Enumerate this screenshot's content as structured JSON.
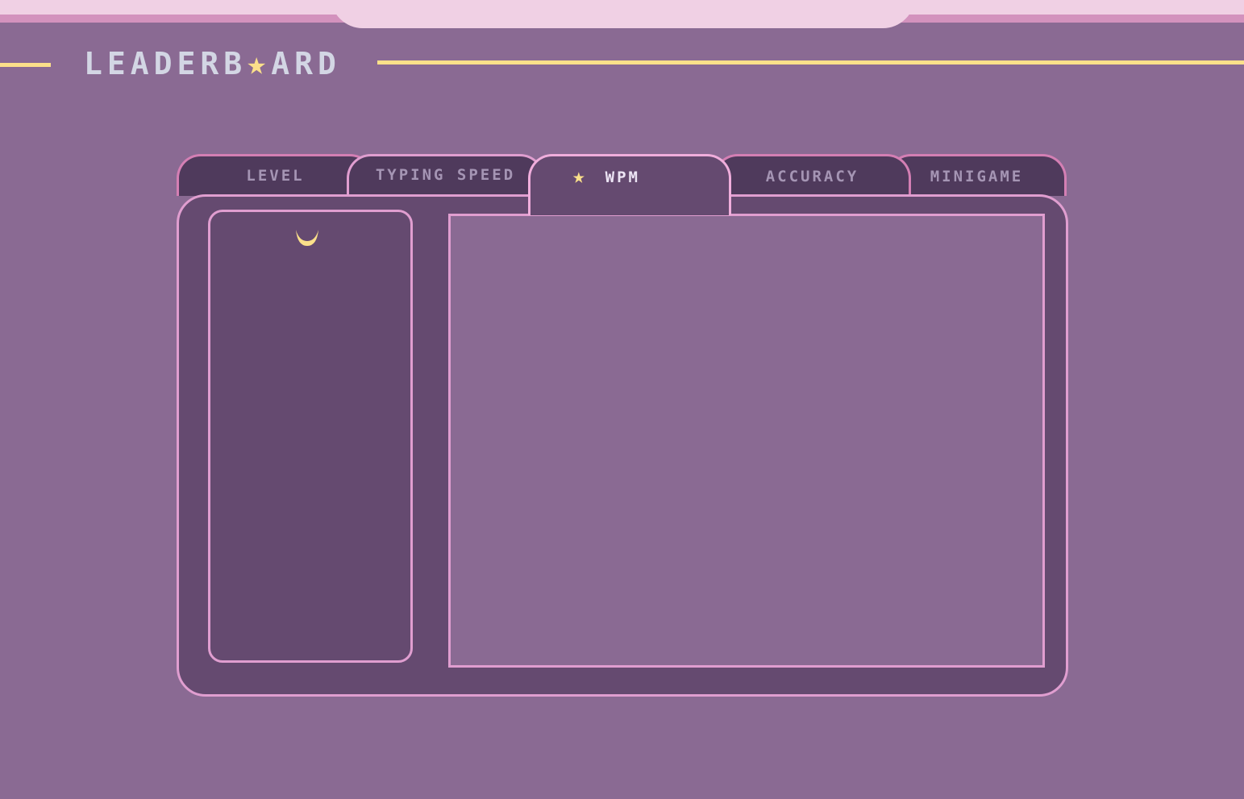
{
  "header": {
    "title_part1": "LEADERB",
    "title_star": "★",
    "title_part2": "ARD"
  },
  "tabs": [
    {
      "id": "level",
      "label": "LEVEL",
      "active": false
    },
    {
      "id": "typing_speed",
      "label": "TYPING SPEED",
      "active": false
    },
    {
      "id": "wpm",
      "label": "WPM",
      "active": true,
      "icon": "star-icon"
    },
    {
      "id": "accuracy",
      "label": "ACCURACY",
      "active": false
    },
    {
      "id": "minigame",
      "label": "MINIGAME",
      "active": false
    }
  ],
  "tab_star": "★",
  "sidebar": {
    "icon": "moon-icon"
  },
  "colors": {
    "background": "#8a6a93",
    "panel": "#654a70",
    "border_pink": "#e09ed0",
    "accent_yellow": "#fbe08a",
    "title_text": "#d3d6e4"
  }
}
